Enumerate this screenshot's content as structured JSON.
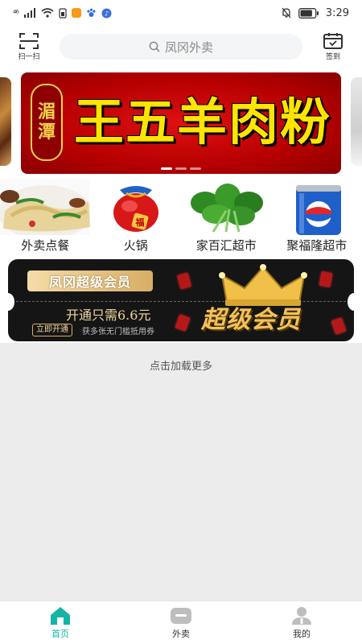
{
  "status_bar": {
    "signal_label": "⁴⁶",
    "time": "3:29",
    "battery_level": 0.85,
    "icons": [
      "signal-icon",
      "wifi-icon",
      "sim-icon",
      "video-app-icon",
      "paw-app-icon",
      "music-app-icon",
      "mute-icon",
      "battery-icon"
    ]
  },
  "header": {
    "scan_label": "扫一扫",
    "search_placeholder": "凤冈外卖",
    "signin_label": "签到"
  },
  "banner": {
    "seal_text": [
      "湄",
      "潭"
    ],
    "title": "王五羊肉粉",
    "slides": 3,
    "active_slide": 0
  },
  "categories": [
    {
      "label": "外卖点餐",
      "icon": "noodle-dish-image"
    },
    {
      "label": "火锅",
      "icon": "hotpot-bag-image"
    },
    {
      "label": "家百汇超市",
      "icon": "vegetables-image"
    },
    {
      "label": "聚福隆超市",
      "icon": "pepsi-can-image"
    }
  ],
  "vip_card": {
    "badge": "凤冈超级会员",
    "price_text": "开通只需6.6元",
    "open_button": "立即开通",
    "subtitle": "获多张无门槛抵用券",
    "big_text": "超级会员",
    "icon": "crown-icon"
  },
  "load_more": "点击加载更多",
  "tabbar": {
    "accent": "#14b5a4",
    "items": [
      {
        "label": "首页",
        "icon": "home-icon",
        "active": true
      },
      {
        "label": "外卖",
        "icon": "takeout-icon",
        "active": false
      },
      {
        "label": "我的",
        "icon": "profile-icon",
        "active": false
      }
    ]
  }
}
